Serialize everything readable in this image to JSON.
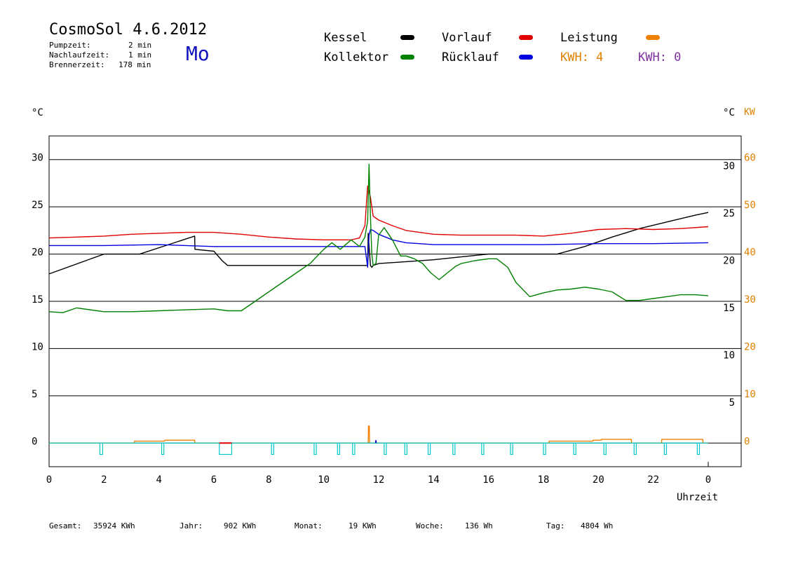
{
  "header": {
    "title": "CosmoSol 4.6.2012",
    "day": "Mo",
    "stats": [
      {
        "label": "Pumpzeit:",
        "value": "2 min"
      },
      {
        "label": "Nachlaufzeit:",
        "value": "1 min"
      },
      {
        "label": "Brennerzeit:",
        "value": "178 min"
      }
    ]
  },
  "legend": {
    "kessel": {
      "label": "Kessel",
      "color": "#000000"
    },
    "kollektor": {
      "label": "Kollektor",
      "color": "#008000"
    },
    "vorlauf": {
      "label": "Vorlauf",
      "color": "#e00000"
    },
    "ruecklauf": {
      "label": "Rücklauf",
      "color": "#0000e0"
    },
    "leistung": {
      "label": "Leistung",
      "color": "#f08000"
    },
    "kwh_orange": "KWH: 4",
    "kwh_purple": "KWH: 0"
  },
  "axes": {
    "left_unit": "°C",
    "right_unit": "°C",
    "right_unit2": "KW",
    "xlabel": "Uhrzeit"
  },
  "footer": [
    {
      "label": "Gesamt:",
      "value": "35924 KWh"
    },
    {
      "label": "Jahr:",
      "value": "902 KWh"
    },
    {
      "label": "Monat:",
      "value": "19 KWh"
    },
    {
      "label": "Woche:",
      "value": "136 Wh"
    },
    {
      "label": "Tag:",
      "value": "4804 Wh"
    }
  ],
  "chart_data": {
    "type": "line",
    "xlim": [
      0,
      24
    ],
    "ylim": [
      -2.5,
      32.5
    ],
    "y2lim": [
      -5,
      65
    ],
    "x_ticks": [
      "0",
      "2",
      "4",
      "6",
      "8",
      "10",
      "12",
      "14",
      "16",
      "18",
      "20",
      "22",
      "0"
    ],
    "y_ticks_left": [
      "0",
      "5",
      "10",
      "15",
      "20",
      "25",
      "30"
    ],
    "y_ticks_right": [
      "5",
      "10",
      "15",
      "20",
      "25",
      "30"
    ],
    "y2_ticks": [
      "0",
      "10",
      "20",
      "30",
      "40",
      "50",
      "60"
    ],
    "grid": true,
    "series": [
      {
        "name": "Kessel",
        "color": "#000000",
        "x": [
          0,
          2,
          2.1,
          3.3,
          5.3,
          5.31,
          6.0,
          6.3,
          6.5,
          11.6,
          11.62,
          11.7,
          11.75,
          11.8,
          12.0,
          13.0,
          14.0,
          15.0,
          16.0,
          16.5,
          18.5,
          19.5,
          20.5,
          21.5,
          22.5,
          23.5,
          24.0
        ],
        "y": [
          17.9,
          20.0,
          20.0,
          20.0,
          21.9,
          20.5,
          20.3,
          19.3,
          18.8,
          18.8,
          22.2,
          18.8,
          18.6,
          18.8,
          19.0,
          19.2,
          19.4,
          19.7,
          20.0,
          20.0,
          20.0,
          20.8,
          21.8,
          22.7,
          23.4,
          24.1,
          24.4
        ]
      },
      {
        "name": "Vorlauf",
        "color": "#e00000",
        "x": [
          0,
          1,
          2,
          3,
          4,
          5,
          6,
          7,
          8,
          9,
          10,
          11,
          11.3,
          11.5,
          11.6,
          11.7,
          11.8,
          12.0,
          12.5,
          13.0,
          14.0,
          15.0,
          16.0,
          17.0,
          18.0,
          19.0,
          20.0,
          21.0,
          22.0,
          23.0,
          24.0
        ],
        "y": [
          21.7,
          21.8,
          21.9,
          22.1,
          22.2,
          22.3,
          22.3,
          22.1,
          21.8,
          21.6,
          21.5,
          21.5,
          21.7,
          23.0,
          27.2,
          26.0,
          24.0,
          23.6,
          23.0,
          22.5,
          22.1,
          22.0,
          22.0,
          22.0,
          21.9,
          22.2,
          22.6,
          22.7,
          22.6,
          22.7,
          22.9
        ]
      },
      {
        "name": "Rücklauf",
        "color": "#0000e0",
        "x": [
          0,
          2,
          4,
          6,
          8,
          10,
          11.5,
          11.6,
          11.65,
          11.7,
          11.8,
          12.0,
          12.5,
          13.0,
          14.0,
          16.0,
          18.0,
          20.0,
          22.0,
          24.0
        ],
        "y": [
          20.9,
          20.9,
          21.0,
          20.8,
          20.8,
          20.8,
          20.8,
          18.6,
          22.0,
          22.6,
          22.5,
          22.1,
          21.5,
          21.2,
          21.0,
          21.0,
          21.0,
          21.1,
          21.1,
          21.2
        ]
      },
      {
        "name": "Kollektor",
        "color": "#008000",
        "x": [
          0,
          0.5,
          1.0,
          2.0,
          3.0,
          4.0,
          5.0,
          6.0,
          6.5,
          7.0,
          7.5,
          8.0,
          8.5,
          9.0,
          9.5,
          10.0,
          10.3,
          10.6,
          11.0,
          11.3,
          11.5,
          11.6,
          11.65,
          11.7,
          11.75,
          11.8,
          11.9,
          12.0,
          12.2,
          12.5,
          12.8,
          13.0,
          13.3,
          13.6,
          13.9,
          14.2,
          14.5,
          14.8,
          15.0,
          15.5,
          16.0,
          16.3,
          16.7,
          17.0,
          17.5,
          18.0,
          18.5,
          19.0,
          19.5,
          20.0,
          20.5,
          21.0,
          21.5,
          22.0,
          22.5,
          23.0,
          23.5,
          24.0
        ],
        "y": [
          13.9,
          13.8,
          14.3,
          13.9,
          13.9,
          14.0,
          14.1,
          14.2,
          14.0,
          14.0,
          15.0,
          16.0,
          17.0,
          18.0,
          19.0,
          20.5,
          21.2,
          20.5,
          21.5,
          20.8,
          21.8,
          23.5,
          29.5,
          24.0,
          20.0,
          18.8,
          19.0,
          22.0,
          22.8,
          21.5,
          19.8,
          19.8,
          19.5,
          19.0,
          18.0,
          17.3,
          18.0,
          18.7,
          19.0,
          19.3,
          19.5,
          19.5,
          18.6,
          17.0,
          15.5,
          15.9,
          16.2,
          16.3,
          16.5,
          16.3,
          16.0,
          15.1,
          15.1,
          15.3,
          15.5,
          15.7,
          15.7,
          15.6
        ]
      },
      {
        "name": "Leistung",
        "color": "#f08000",
        "x": [
          0,
          3.1,
          3.11,
          4.2,
          4.21,
          5.3,
          5.31,
          11.62,
          11.63,
          11.66,
          11.67,
          18.2,
          18.21,
          19.8,
          19.81,
          20.1,
          20.11,
          21.2,
          21.21,
          22.3,
          22.31,
          23.8,
          23.81,
          24.0
        ],
        "y": [
          0,
          0,
          0.2,
          0.2,
          0.3,
          0.3,
          0,
          0,
          1.8,
          1.8,
          0,
          0,
          0.2,
          0.2,
          0.3,
          0.3,
          0.4,
          0.4,
          0,
          0,
          0.4,
          0.4,
          0,
          0
        ]
      },
      {
        "name": "Pumpe",
        "color": "#00c8c8",
        "x": [
          1.85,
          1.95,
          4.1,
          4.18,
          6.2,
          6.65,
          8.1,
          8.18,
          9.65,
          9.73,
          10.5,
          10.58,
          11.05,
          11.13,
          12.2,
          12.28,
          12.95,
          13.03,
          13.8,
          13.88,
          14.7,
          14.78,
          15.75,
          15.83,
          16.8,
          16.88,
          18.0,
          18.08,
          19.1,
          19.18,
          20.2,
          20.28,
          21.3,
          21.38,
          22.4,
          22.48,
          23.6,
          23.68
        ],
        "y": [
          -1.2,
          -1.2,
          -1.2,
          -1.2,
          -1.2,
          -1.2,
          -1.2,
          -1.2,
          -1.2,
          -1.2,
          -1.2,
          -1.2,
          -1.2,
          -1.2,
          -1.2,
          -1.2,
          -1.2,
          -1.2,
          -1.2,
          -1.2,
          -1.2,
          -1.2,
          -1.2,
          -1.2,
          -1.2,
          -1.2,
          -1.2,
          -1.2,
          -1.2,
          -1.2,
          -1.2,
          -1.2,
          -1.2,
          -1.2,
          -1.2,
          -1.2,
          -1.2,
          -1.2
        ]
      }
    ]
  }
}
